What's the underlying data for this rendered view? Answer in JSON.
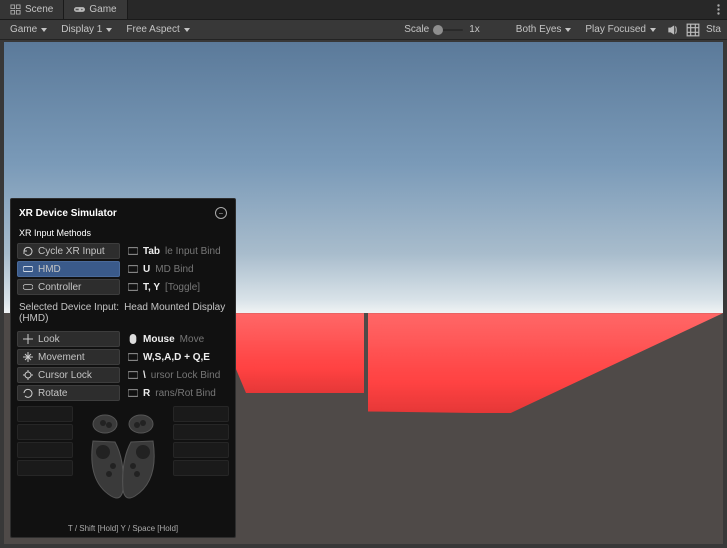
{
  "tabs": {
    "scene": "Scene",
    "game": "Game"
  },
  "toolbar": {
    "camera_dd": "Game",
    "display_dd": "Display 1",
    "aspect_dd": "Free Aspect",
    "scale_label": "Scale",
    "scale_value": "1x",
    "eyes_dd": "Both Eyes",
    "play_dd": "Play Focused",
    "stats": "Sta"
  },
  "xr": {
    "title": "XR Device Simulator",
    "section_input_methods": "XR Input Methods",
    "cycle": "Cycle XR Input",
    "hmd": "HMD",
    "controller": "Controller",
    "tab_bind_k": "Tab",
    "tab_bind_v": "le Input Bind",
    "u_bind_k": "U",
    "u_bind_v": "MD Bind",
    "ty_bind_k": "T, Y",
    "ty_bind_v": "[Toggle]",
    "sdi_label": "Selected Device Input:",
    "sdi_value": "Head Mounted Display (HMD)",
    "look": "Look",
    "movement": "Movement",
    "cursor_lock": "Cursor Lock",
    "rotate": "Rotate",
    "mouse_k": "Mouse",
    "mouse_v": "Move",
    "wsad_k": "W,S,A,D + Q,E",
    "wsad_v": "",
    "lock_k": "",
    "lock_v": "ursor Lock Bind",
    "r_k": "R",
    "r_v": "rans/Rot Bind",
    "left_btns": [
      "",
      "",
      "",
      ""
    ],
    "right_btns": [
      "",
      "",
      "",
      ""
    ],
    "footer": "T / Shift [Hold]   Y / Space [Hold]"
  }
}
